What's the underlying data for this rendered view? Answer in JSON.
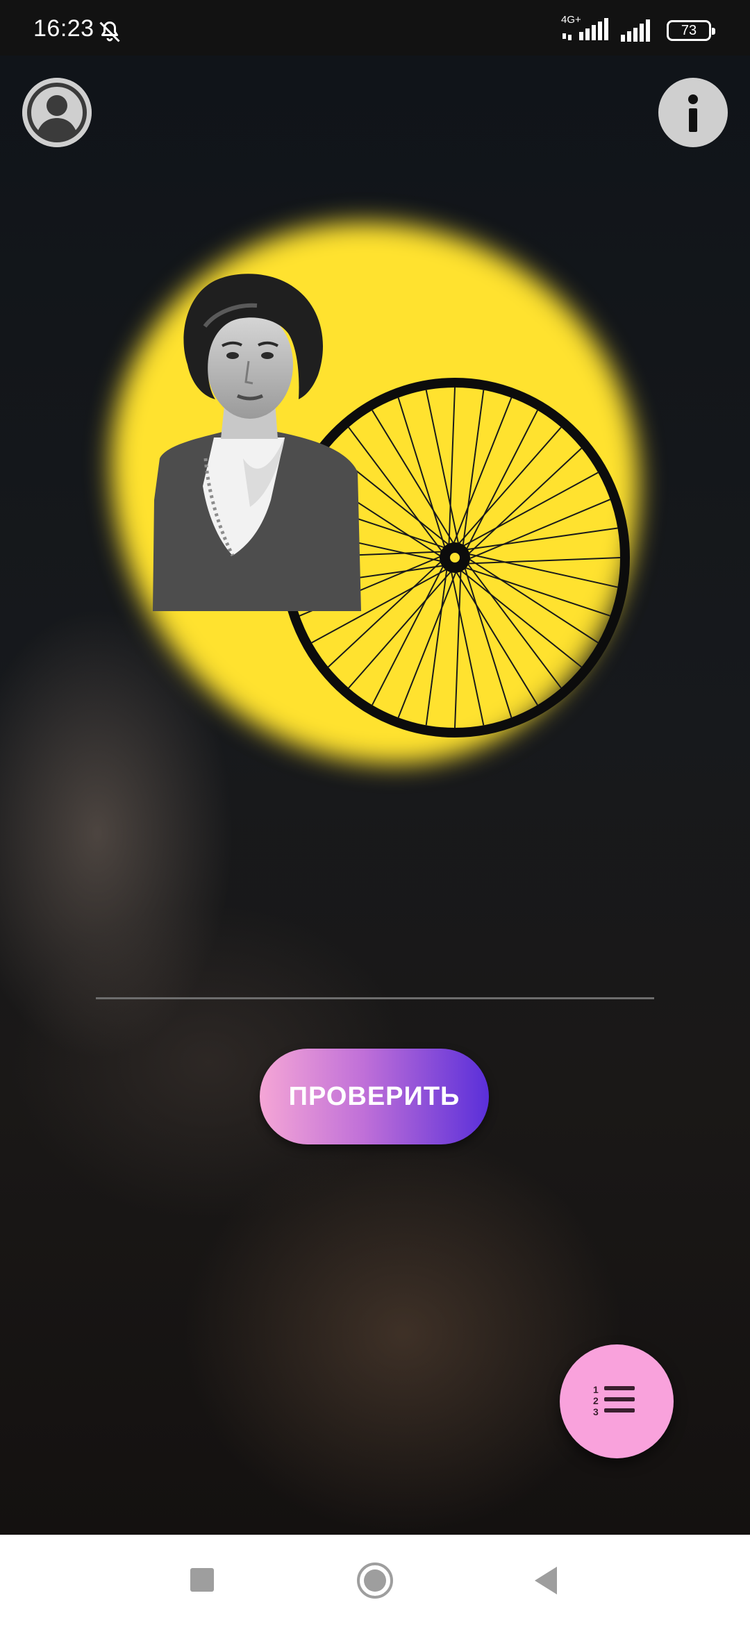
{
  "status_bar": {
    "time": "16:23",
    "network_label": "4G+",
    "battery_level": "73",
    "icons": [
      "bell-off-icon",
      "signal-icon",
      "signal-icon",
      "battery-icon"
    ]
  },
  "header": {
    "profile_icon": "account-circle-icon",
    "info_icon": "info-icon"
  },
  "puzzle": {
    "highlight_color": "#ffe22f",
    "elements": [
      "portrait-photo",
      "bicycle-wheel"
    ]
  },
  "answer": {
    "value": "",
    "placeholder": ""
  },
  "actions": {
    "check_label": "ПРОВЕРИТЬ",
    "check_gradient": [
      "#f5a6d6",
      "#5a2fd9"
    ],
    "list_icon": "numbered-list-icon",
    "list_color": "#f9a2dc"
  },
  "nav": {
    "icons": [
      "recents-square-icon",
      "home-circle-icon",
      "back-triangle-icon"
    ]
  }
}
